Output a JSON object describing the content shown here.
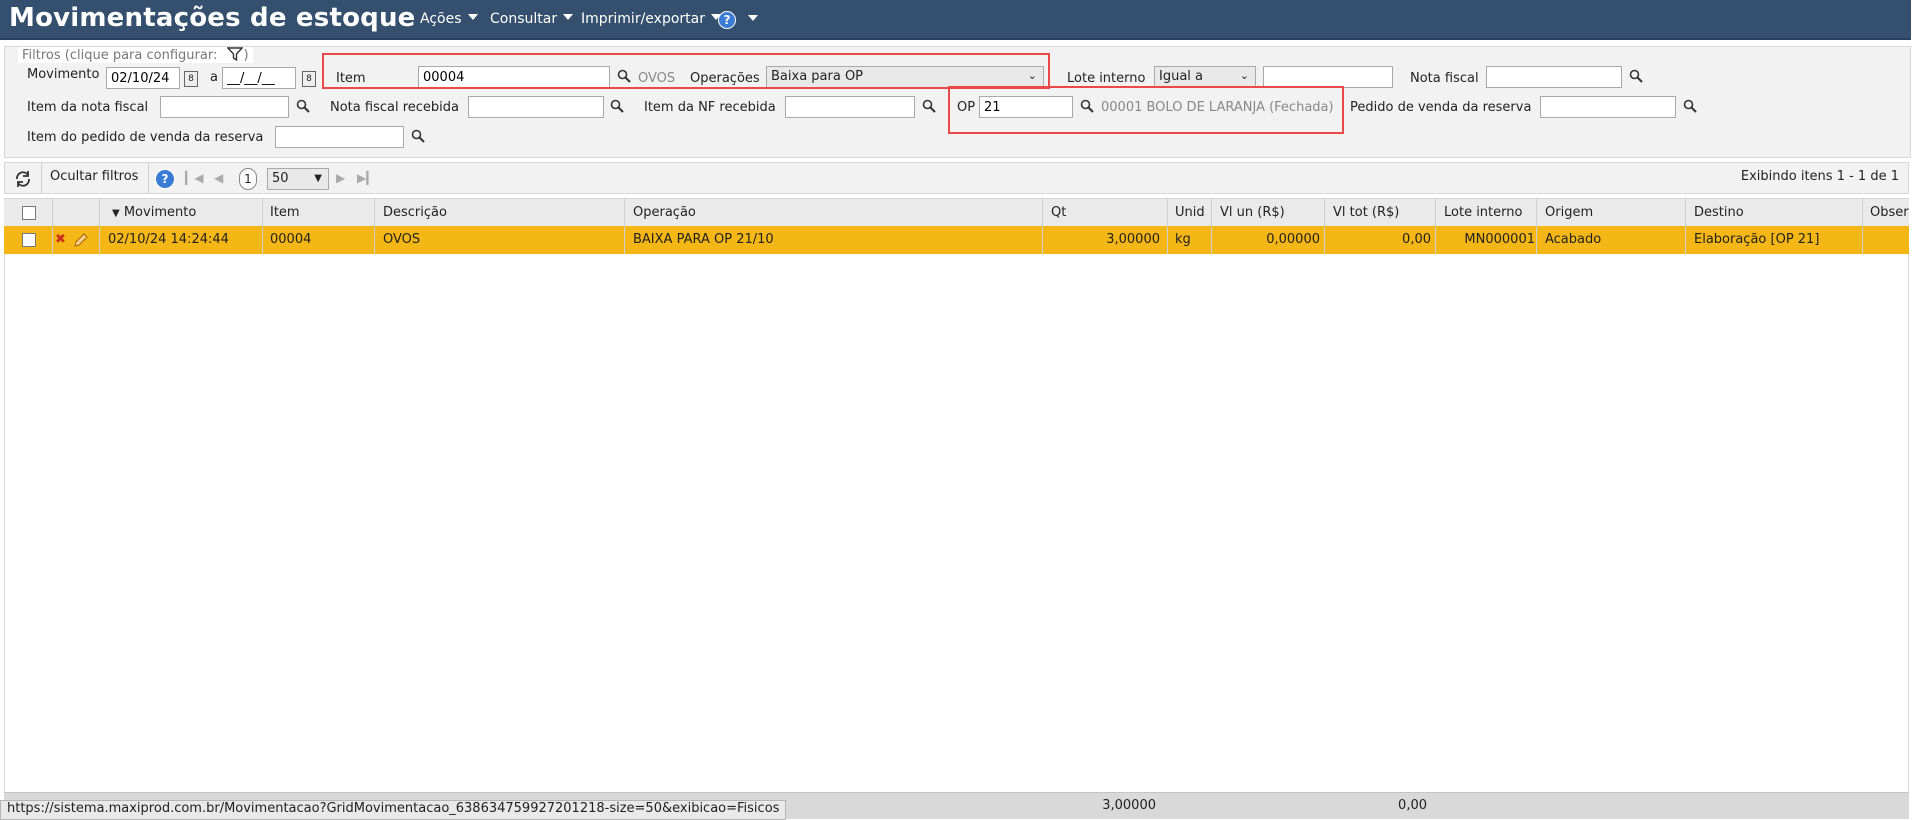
{
  "header": {
    "title": "Movimentações de estoque",
    "menus": [
      "Ações",
      "Consultar",
      "Imprimir/exportar"
    ],
    "help": "?"
  },
  "filters": {
    "legend": "Filtros (clique para configurar:",
    "legend_close": ")",
    "movimento_label": "Movimento",
    "movimento_from": "02/10/24",
    "movimento_sep": "a",
    "movimento_to": "__/__/__",
    "item_label": "Item",
    "item_value": "00004",
    "item_desc": "OVOS",
    "operacoes_label": "Operações",
    "operacoes_value": "Baixa para OP",
    "lote_label": "Lote interno",
    "lote_op": "Igual a",
    "lote_value": "",
    "nota_label": "Nota fiscal",
    "nota_value": "",
    "item_nota_label": "Item da nota fiscal",
    "item_nota_value": "",
    "nf_receb_label": "Nota fiscal recebida",
    "nf_receb_value": "",
    "item_nf_receb_label": "Item da NF recebida",
    "item_nf_receb_value": "",
    "op_label": "OP",
    "op_value": "21",
    "op_desc": "00001 BOLO DE LARANJA (Fechada)",
    "pedido_label": "Pedido de venda da reserva",
    "pedido_value": "",
    "item_pedido_label": "Item do pedido de venda da reserva",
    "item_pedido_value": ""
  },
  "toolbar": {
    "hide_filters": "Ocultar filtros",
    "help": "?",
    "page": "1",
    "page_size": "50",
    "showing": "Exibindo itens 1 - 1 de 1"
  },
  "grid": {
    "columns": [
      "Movimento",
      "Item",
      "Descrição",
      "Operação",
      "Qt",
      "Unid",
      "Vl un (R$)",
      "Vl tot (R$)",
      "Lote interno",
      "Origem",
      "Destino",
      "Obser"
    ],
    "rows": [
      {
        "movimento": "02/10/24 14:24:44",
        "item": "00004",
        "descricao": "OVOS",
        "operacao": "BAIXA PARA OP 21/10",
        "qt": "3,00000",
        "unid": "kg",
        "vl_un": "0,00000",
        "vl_tot": "0,00",
        "lote": "MN000001",
        "origem": "Acabado",
        "destino": "Elaboração [OP 21]",
        "obser": ""
      }
    ],
    "totals": {
      "qt": "3,00000",
      "vl_tot": "0,00"
    }
  },
  "statusbar": {
    "url": "https://sistema.maxiprod.com.br/Movimentacao?GridMovimentacao_638634759927201218-size=50&exibicao=Fisicos"
  },
  "colors": {
    "header_bg": "#35506f",
    "row_selected": "#f5b715",
    "highlight_box": "#e84a4a"
  }
}
